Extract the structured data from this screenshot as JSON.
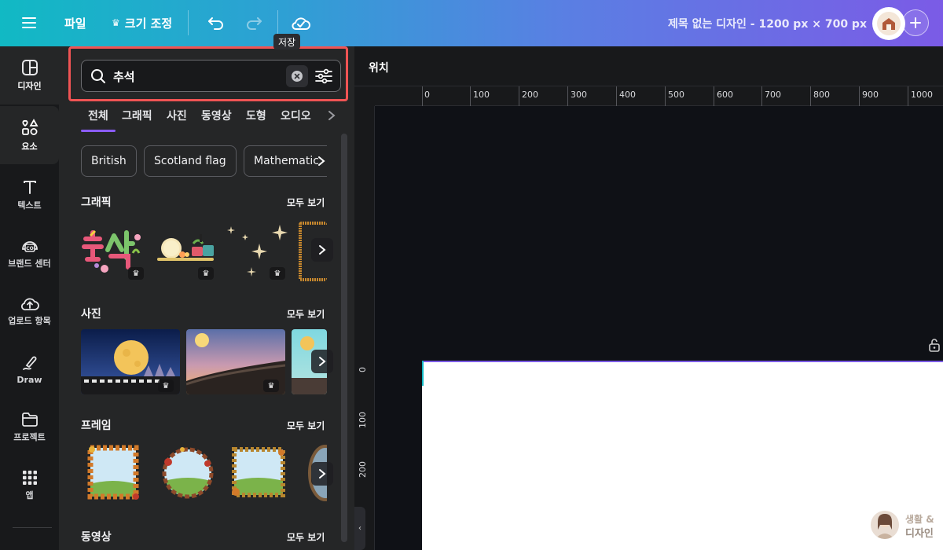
{
  "topbar": {
    "file_label": "파일",
    "resize_label": "크기 조정",
    "tooltip": "저장",
    "doc_title": "제목 없는 디자인 - 1200 px × 700 px"
  },
  "rail": {
    "items": [
      {
        "label": "디자인",
        "icon": "layout-icon"
      },
      {
        "label": "요소",
        "icon": "shapes-icon"
      },
      {
        "label": "텍스트",
        "icon": "text-icon"
      },
      {
        "label": "브랜드 센터",
        "icon": "brand-icon"
      },
      {
        "label": "업로드 항목",
        "icon": "upload-icon"
      },
      {
        "label": "Draw",
        "icon": "draw-icon"
      },
      {
        "label": "프로젝트",
        "icon": "folder-icon"
      },
      {
        "label": "앱",
        "icon": "apps-icon"
      }
    ]
  },
  "search": {
    "value": "추석",
    "placeholder": ""
  },
  "tabs": [
    "전체",
    "그래픽",
    "사진",
    "동영상",
    "도형",
    "오디오"
  ],
  "chips": [
    "British",
    "Scotland flag",
    "Mathematic"
  ],
  "sections": {
    "graphics": {
      "title": "그래픽",
      "see_all": "모두 보기"
    },
    "photos": {
      "title": "사진",
      "see_all": "모두 보기"
    },
    "frames": {
      "title": "프레임",
      "see_all": "모두 보기"
    },
    "videos": {
      "title": "동영상",
      "see_all": "모두 보기"
    }
  },
  "canvas": {
    "position_label": "위치",
    "ruler_top": [
      "0",
      "100",
      "200",
      "300",
      "400",
      "500",
      "600",
      "700",
      "800",
      "900",
      "1000"
    ],
    "ruler_left": [
      "0",
      "100",
      "200"
    ]
  },
  "watermark": {
    "line1": "생활 &",
    "line2": "디자인"
  },
  "colors": {
    "accent": "#8b5cf6",
    "highlight": "#f05454",
    "gradient_start": "#11b9c4",
    "gradient_end": "#7b5be6"
  }
}
